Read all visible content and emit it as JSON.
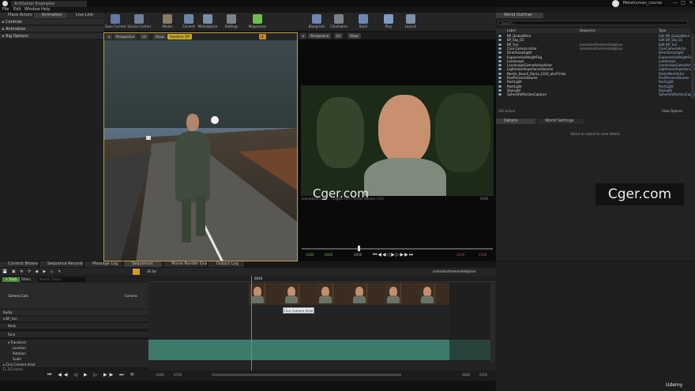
{
  "titlebar": {
    "tab": "ArtStation Examples",
    "project": "Metahuman_course",
    "min": "—",
    "max": "□",
    "close": "✕"
  },
  "menu": [
    "File",
    "Edit",
    "Window",
    "Help"
  ],
  "left_panel": {
    "tabs": [
      "Place Actors",
      "Animation",
      "Live Link"
    ],
    "sections": [
      "Controls",
      "Animation",
      "Rig Options"
    ]
  },
  "toolbar": {
    "buttons": [
      "Save Current",
      "Source Control",
      "Modes",
      "Content",
      "Marketplace",
      "Settings",
      "Megascans",
      "Blueprints",
      "Cinematics",
      "Build",
      "Play",
      "Launch"
    ]
  },
  "viewport_left": {
    "perspective": "Perspective",
    "lit": "Lit",
    "show": "Show",
    "realtime": "Realtime Off",
    "value": "4"
  },
  "viewport_right": {
    "perspective": "Perspective",
    "lit": "Lit",
    "show": "Show",
    "path": "animationfromn... | Digital Film (35mm 36mm) | 0.0",
    "frame": "0500",
    "start": "-1000",
    "cur1": "0000",
    "cur2": "0000",
    "end": "2200",
    "end2": "2200"
  },
  "outliner": {
    "title": "World Outliner",
    "search_placeholder": "Search...",
    "col_label": "Label",
    "col_seq": "Sequence",
    "col_type": "Type",
    "rows": [
      {
        "name": "BP_GlobalWind",
        "seq": "",
        "type": "Edit BP_GlobalWind"
      },
      {
        "name": "BP_Sky_01",
        "seq": "",
        "type": "Edit BP_Sky_01"
      },
      {
        "name": "BP_Yuri",
        "seq": "animationfrommarketplace",
        "type": "Edit BP_Yuri"
      },
      {
        "name": "Cine Camera Actor",
        "seq": "animationfrommarketplace",
        "type": "CineCameraActor"
      },
      {
        "name": "DirectionalLight",
        "seq": "",
        "type": "DirectionalLight"
      },
      {
        "name": "ExponentialHeightFog",
        "seq": "",
        "type": "ExponentialHeightFog"
      },
      {
        "name": "Landscape",
        "seq": "",
        "type": "Landscape"
      },
      {
        "name": "LandscapeGizmoActiveActor",
        "seq": "",
        "type": "LandscapeGizmoActiveActor"
      },
      {
        "name": "LightmassImportanceVolume",
        "seq": "",
        "type": "LightmassImportanceVolume"
      },
      {
        "name": "Nordic_Beach_Rocks_L030_aknf7mlw",
        "seq": "",
        "type": "StaticMeshActor"
      },
      {
        "name": "PostProcessVolume",
        "seq": "",
        "type": "PostProcessVolume"
      },
      {
        "name": "RectLight",
        "seq": "",
        "type": "RectLight"
      },
      {
        "name": "RectLight",
        "seq": "",
        "type": "RectLight"
      },
      {
        "name": "SkyLight",
        "seq": "",
        "type": "SkyLight"
      },
      {
        "name": "SphereReflectionCapture",
        "seq": "",
        "type": "SphereReflectionCapture"
      }
    ],
    "count": "263 actors",
    "view_options": "View Options"
  },
  "details": {
    "tabs": [
      "Details",
      "World Settings"
    ],
    "empty": "Select an object to view details."
  },
  "bottom_tabs": [
    "Content Browser",
    "Sequence Recorder",
    "Message Log",
    "Sequencer",
    "Movie Render Queue",
    "Output Log"
  ],
  "sequencer": {
    "fps": "30 fps",
    "track_btn": "+ Track",
    "filters": "Filters",
    "search_placeholder": "Search Tracks",
    "breadcrumb": "animationfrommarketplace",
    "playhead": "0046",
    "camera_cuts": "Camera Cuts",
    "camera_btn": "Camera",
    "tracks": [
      "Audio",
      "BP_Yuri",
      "Body",
      "Face",
      "Transform",
      "Location",
      "Rotation",
      "Scale",
      "Cine Camera Actor"
    ],
    "item_count": "11,263 items",
    "tooltip": "Cine Camera Actor",
    "range_start": "-1000",
    "range_start2": "0700",
    "range_end": "0080",
    "range_end2": "0200"
  },
  "watermark": {
    "center": "Cger.com",
    "right": "Cger.com",
    "udemy": "Udemy"
  }
}
